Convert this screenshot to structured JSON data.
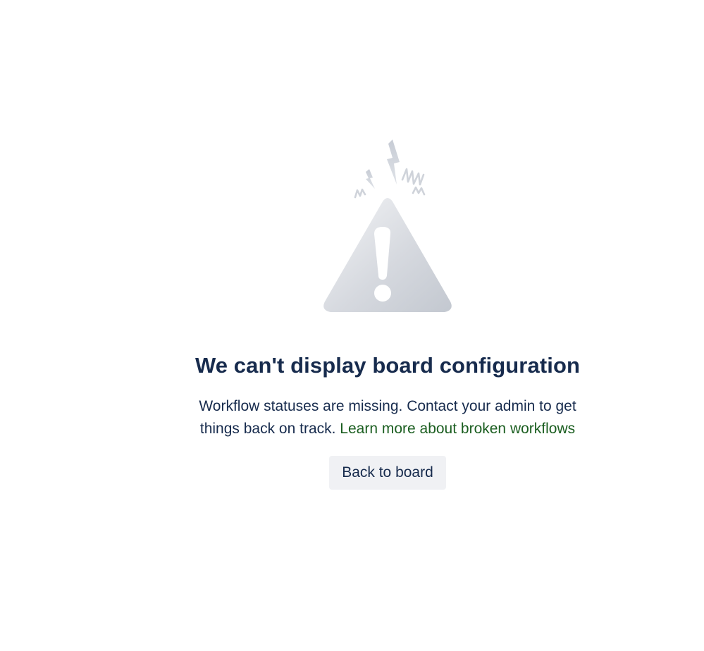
{
  "empty_state": {
    "illustration_icon": "warning-triangle-icon",
    "title": "We can't display board configuration",
    "description_text": "Workflow statuses are missing. Contact your admin to get things back on track. ",
    "learn_more_link": "Learn more about broken workflows",
    "back_button_label": "Back to board"
  },
  "colors": {
    "text_primary": "#172b4d",
    "link": "#1b5e20",
    "button_background": "#f0f1f4",
    "illustration_gray": "#c1c7d0"
  }
}
